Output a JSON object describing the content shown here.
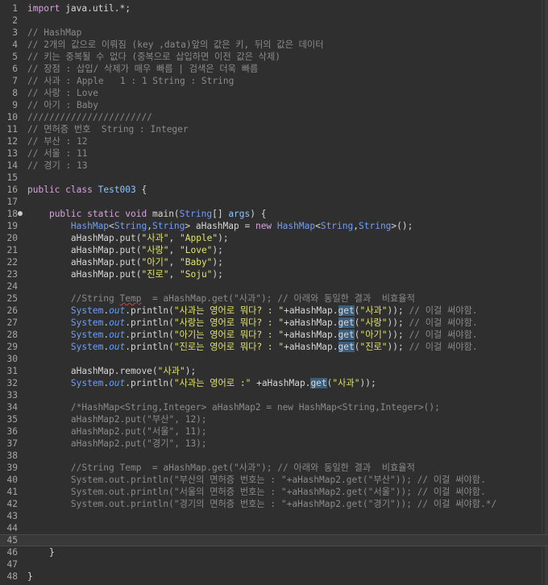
{
  "lines": [
    {
      "n": "1",
      "t": "import java.util.*;"
    },
    {
      "n": "2",
      "t": ""
    },
    {
      "n": "3",
      "t": "// HashMap"
    },
    {
      "n": "4",
      "t": "// 2개의 값으로 이뤄짐 (key ,data)앞의 값은 키, 뒤의 값은 데이터"
    },
    {
      "n": "5",
      "t": "// 키는 중복될 수 없다 (중복으로 삽입하면 이전 값은 삭제)"
    },
    {
      "n": "6",
      "t": "// 장점 : 삽입/ 삭제가 매우 빠름 | 검색은 더욱 빠름"
    },
    {
      "n": "7",
      "t": "// 사과 : Apple   1 : 1 String : String"
    },
    {
      "n": "8",
      "t": "// 사랑 : Love"
    },
    {
      "n": "9",
      "t": "// 아기 : Baby"
    },
    {
      "n": "10",
      "t": "///////////////////////"
    },
    {
      "n": "11",
      "t": "// 면허증 번호  String : Integer"
    },
    {
      "n": "12",
      "t": "// 부산 : 12"
    },
    {
      "n": "13",
      "t": "// 서울 : 11"
    },
    {
      "n": "14",
      "t": "// 경기 : 13"
    },
    {
      "n": "15",
      "t": ""
    },
    {
      "n": "16",
      "t": "public class Test003 {"
    },
    {
      "n": "17",
      "t": ""
    },
    {
      "n": "18",
      "t": "    public static void main(String[] args) {"
    },
    {
      "n": "19",
      "t": "        HashMap<String,String> aHashMap = new HashMap<String,String>();"
    },
    {
      "n": "20",
      "t": "        aHashMap.put(\"사과\", \"Apple\");"
    },
    {
      "n": "21",
      "t": "        aHashMap.put(\"사랑\", \"Love\");"
    },
    {
      "n": "22",
      "t": "        aHashMap.put(\"아기\", \"Baby\");"
    },
    {
      "n": "23",
      "t": "        aHashMap.put(\"진로\", \"Soju\");"
    },
    {
      "n": "24",
      "t": ""
    },
    {
      "n": "25",
      "t": "        //String Temp  = aHashMap.get(\"사과\"); // 아래와 동일한 결과  비효율적"
    },
    {
      "n": "26",
      "t": "        System.out.println(\"사과는 영어로 뭐다? : \"+aHashMap.get(\"사과\")); // 이걸 써야함."
    },
    {
      "n": "27",
      "t": "        System.out.println(\"사랑는 영어로 뭐다? : \"+aHashMap.get(\"사랑\")); // 이걸 써야함."
    },
    {
      "n": "28",
      "t": "        System.out.println(\"아기는 영어로 뭐다? : \"+aHashMap.get(\"아기\")); // 이걸 써야함."
    },
    {
      "n": "29",
      "t": "        System.out.println(\"진로는 영어로 뭐다? : \"+aHashMap.get(\"진로\")); // 이걸 써야함."
    },
    {
      "n": "30",
      "t": ""
    },
    {
      "n": "31",
      "t": "        aHashMap.remove(\"사과\");"
    },
    {
      "n": "32",
      "t": "        System.out.println(\"사과는 영어로 :\" +aHashMap.get(\"사과\"));"
    },
    {
      "n": "33",
      "t": ""
    },
    {
      "n": "34",
      "t": "        /*HashMap<String,Integer> aHashMap2 = new HashMap<String,Integer>();"
    },
    {
      "n": "35",
      "t": "        aHashMap2.put(\"부산\", 12);"
    },
    {
      "n": "36",
      "t": "        aHashMap2.put(\"서울\", 11);"
    },
    {
      "n": "37",
      "t": "        aHashMap2.put(\"경기\", 13);"
    },
    {
      "n": "38",
      "t": ""
    },
    {
      "n": "39",
      "t": "        //String Temp  = aHashMap.get(\"사과\"); // 아래와 동일한 결과  비효율적"
    },
    {
      "n": "40",
      "t": "        System.out.println(\"부산의 면허증 번호는 : \"+aHashMap2.get(\"부산\")); // 이걸 써야함."
    },
    {
      "n": "41",
      "t": "        System.out.println(\"서울의 면허증 번호는 : \"+aHashMap2.get(\"서울\")); // 이걸 써야함."
    },
    {
      "n": "42",
      "t": "        System.out.println(\"경기의 면허증 번호는 : \"+aHashMap2.get(\"경기\")); // 이걸 써야함.*/"
    },
    {
      "n": "43",
      "t": ""
    },
    {
      "n": "44",
      "t": ""
    },
    {
      "n": "45",
      "t": ""
    },
    {
      "n": "46",
      "t": "    }"
    },
    {
      "n": "47",
      "t": ""
    },
    {
      "n": "48",
      "t": "}"
    }
  ],
  "current_line": "45",
  "fold_marker_line": "18",
  "colors": {
    "background": "#2f2f2f",
    "keyword": "#d8a0df",
    "type": "#6f9ff7",
    "comment": "#8a8a8a",
    "string": "#e3e36b",
    "static_field": "#5e9cff",
    "variable": "#ffff80",
    "occurrence_highlight": "#3b5e7d"
  }
}
